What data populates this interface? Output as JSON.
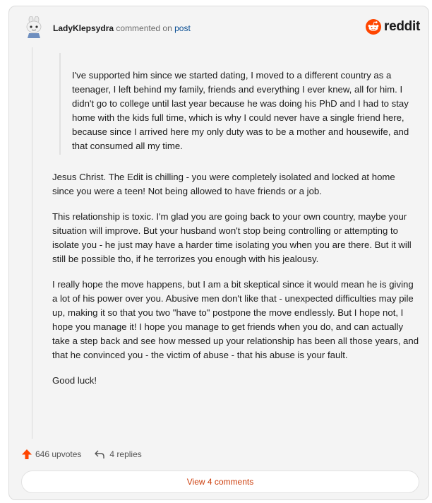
{
  "header": {
    "author": "LadyKlepsydra",
    "action_text": "commented on",
    "post_link": "post",
    "brand": "reddit"
  },
  "comment": {
    "quote": "I've supported him since we started dating, I moved to a different country as a teenager, I left behind my family, friends and everything I ever knew, all for him. I didn't go to college until last year because he was doing his PhD and I had to stay home with the kids full time, which is why I could never have a single friend here, because since I arrived here my only duty was to be a mother and housewife, and that consumed all my time.",
    "paragraphs": [
      "Jesus Christ. The Edit is chilling - you were completely isolated and locked at home since you were a teen! Not being allowed to have friends or a job.",
      "This relationship is toxic. I'm glad you are going back to your own country, maybe your situation will improve. But your husband won't stop being controlling or attempting to isolate you - he just may have a harder time isolating you when you are there. But it will still be possible tho, if he terrorizes you enough with his jealousy.",
      "I really hope the move happens, but I am a bit skeptical since it would mean he is giving a lot of his power over you. Abusive men don't like that - unexpected difficulties may pile up, making it so that you two \"have to\" postpone the move endlessly. But I hope not, I hope you manage it! I hope you manage to get friends when you do, and can actually take a step back and see how messed up your relationship has been all those years, and that he convinced you - the victim of abuse - that his abuse is your fault.",
      "Good luck!"
    ]
  },
  "actions": {
    "upvotes": "646 upvotes",
    "replies": "4 replies",
    "view_comments": "View 4 comments"
  },
  "colors": {
    "brand": "#ff4500",
    "link": "#0b4f94",
    "view_comments": "#cc3d0b"
  },
  "icons": [
    "snoo-avatar-icon",
    "reddit-logo-icon",
    "upvote-arrow-icon",
    "reply-arrow-icon"
  ]
}
